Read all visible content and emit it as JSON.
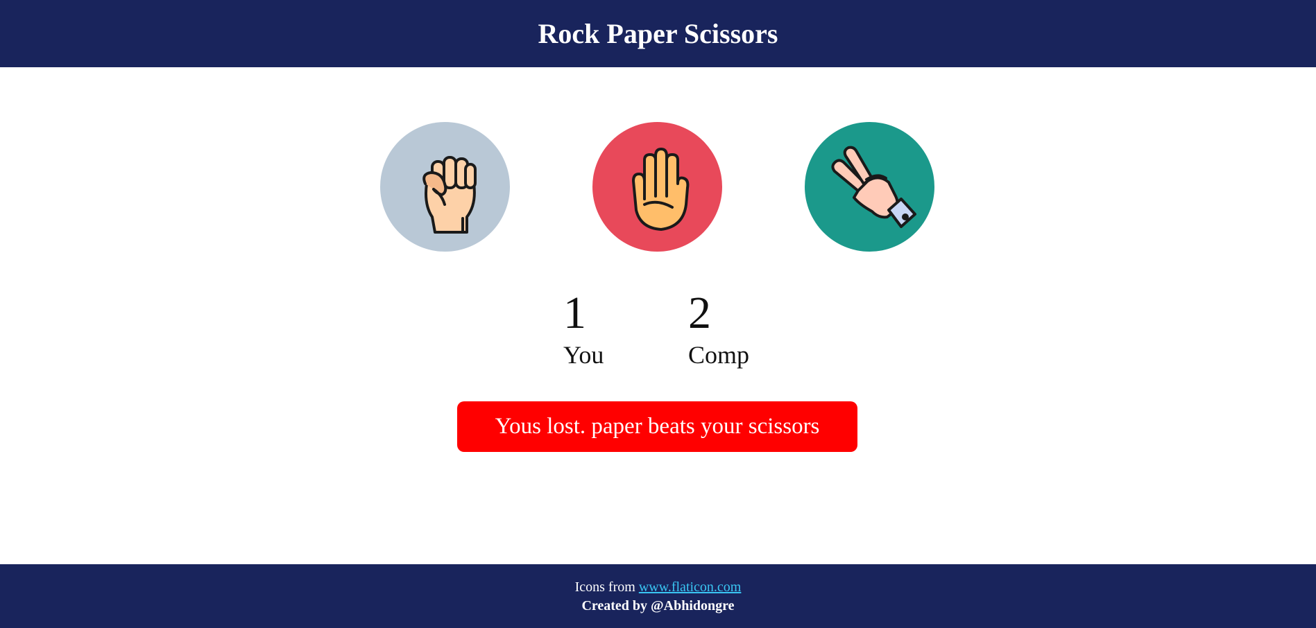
{
  "header": {
    "title": "Rock Paper Scissors",
    "background": "#19245c"
  },
  "choices": [
    {
      "id": "rock",
      "icon": "rock-fist-icon",
      "background": "#b9c8d6"
    },
    {
      "id": "paper",
      "icon": "paper-hand-icon",
      "background": "#e8495a"
    },
    {
      "id": "scissors",
      "icon": "scissors-hand-icon",
      "background": "#1b998b"
    }
  ],
  "scoreboard": {
    "user_score": "1",
    "user_label": "You",
    "comp_score": "2",
    "comp_label": "Comp"
  },
  "message": {
    "text": "Yous lost. paper beats your scissors",
    "background": "#ff0000"
  },
  "footer": {
    "credit_prefix": "Icons from",
    "credit_link_text": "www.flaticon.com",
    "created_by": "Created by @Abhidongre",
    "background": "#19245c",
    "link_color": "#3ac6f3"
  }
}
